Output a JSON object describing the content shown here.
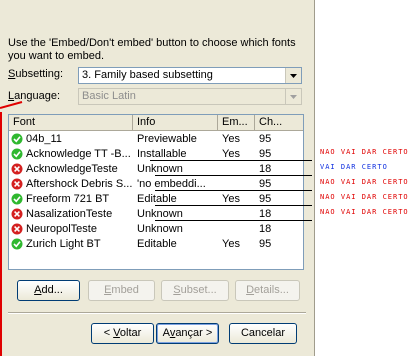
{
  "description": "Use the 'Embed/Don't embed' button to choose which fonts you want to embed.",
  "subsetting": {
    "label": "Subsetting:",
    "value": "3. Family based subsetting"
  },
  "language": {
    "label": "Language:",
    "value": "Basic Latin"
  },
  "columns": [
    "Font",
    "Info",
    "Em...",
    "Ch..."
  ],
  "fonts": [
    {
      "status": "ok",
      "name": "04b_11",
      "info": "Previewable",
      "embed": "Yes",
      "chars": "95"
    },
    {
      "status": "ok",
      "name": "Acknowledge TT -B...",
      "info": "Installable",
      "embed": "Yes",
      "chars": "95"
    },
    {
      "status": "bad",
      "name": "AcknowledgeTeste",
      "info": "Unknown",
      "embed": "",
      "chars": "18"
    },
    {
      "status": "bad",
      "name": "Aftershock Debris S...",
      "info": "'no embeddi...",
      "embed": "",
      "chars": "95"
    },
    {
      "status": "ok",
      "name": "Freeform 721 BT",
      "info": "Editable",
      "embed": "Yes",
      "chars": "95"
    },
    {
      "status": "bad",
      "name": "NasalizationTeste",
      "info": "Unknown",
      "embed": "",
      "chars": "18"
    },
    {
      "status": "bad",
      "name": "NeuropolTeste",
      "info": "Unknown",
      "embed": "",
      "chars": "18"
    },
    {
      "status": "ok",
      "name": "Zurich Light BT",
      "info": "Editable",
      "embed": "Yes",
      "chars": "95"
    }
  ],
  "buttons": {
    "add": "Add...",
    "embed": "Embed",
    "subset": "Subset...",
    "details": "Details...",
    "back": "< Voltar",
    "next": "Avançar >",
    "cancel": "Cancelar"
  },
  "annotations": [
    {
      "text": "NAO VAI DAR CERTO",
      "color": "#e00000"
    },
    {
      "text": "VAI DAR CERTO",
      "color": "#1030e0"
    },
    {
      "text": "NAO VAI DAR CERTO",
      "color": "#e00000"
    },
    {
      "text": "NAO VAI DAR CERTO",
      "color": "#e00000"
    },
    {
      "text": "NAO VAI DAR CERTO",
      "color": "#e00000"
    }
  ],
  "colors": {
    "dialog_bg": "#ece9d8",
    "ok_green": "#2fb82f",
    "bad_red": "#d42020",
    "annotation_red": "#e00000",
    "annotation_blue": "#1030e0"
  }
}
